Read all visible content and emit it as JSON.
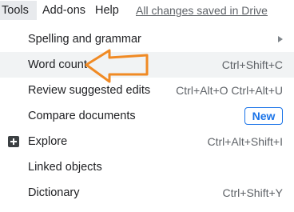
{
  "menubar": {
    "tools": "Tools",
    "addons": "Add-ons",
    "help": "Help",
    "saved_status": "All changes saved in Drive"
  },
  "menu": {
    "items": [
      {
        "label": "Spelling and grammar",
        "shortcut": "",
        "submenu": true
      },
      {
        "label": "Word count",
        "shortcut": "Ctrl+Shift+C"
      },
      {
        "label": "Review suggested edits",
        "shortcut": "Ctrl+Alt+O Ctrl+Alt+U"
      },
      {
        "label": "Compare documents",
        "badge": "New"
      },
      {
        "label": "Explore",
        "shortcut": "Ctrl+Alt+Shift+I",
        "icon": "explore-icon"
      },
      {
        "label": "Linked objects",
        "shortcut": ""
      },
      {
        "label": "Dictionary",
        "shortcut": "Ctrl+Shift+Y"
      }
    ]
  },
  "annotation": {
    "arrow_color": "#f08a24",
    "points_to": "Word count"
  },
  "colors": {
    "highlight": "#f1f3f4",
    "accent": "#1a73e8",
    "text": "#202124",
    "muted": "#5f6368"
  }
}
